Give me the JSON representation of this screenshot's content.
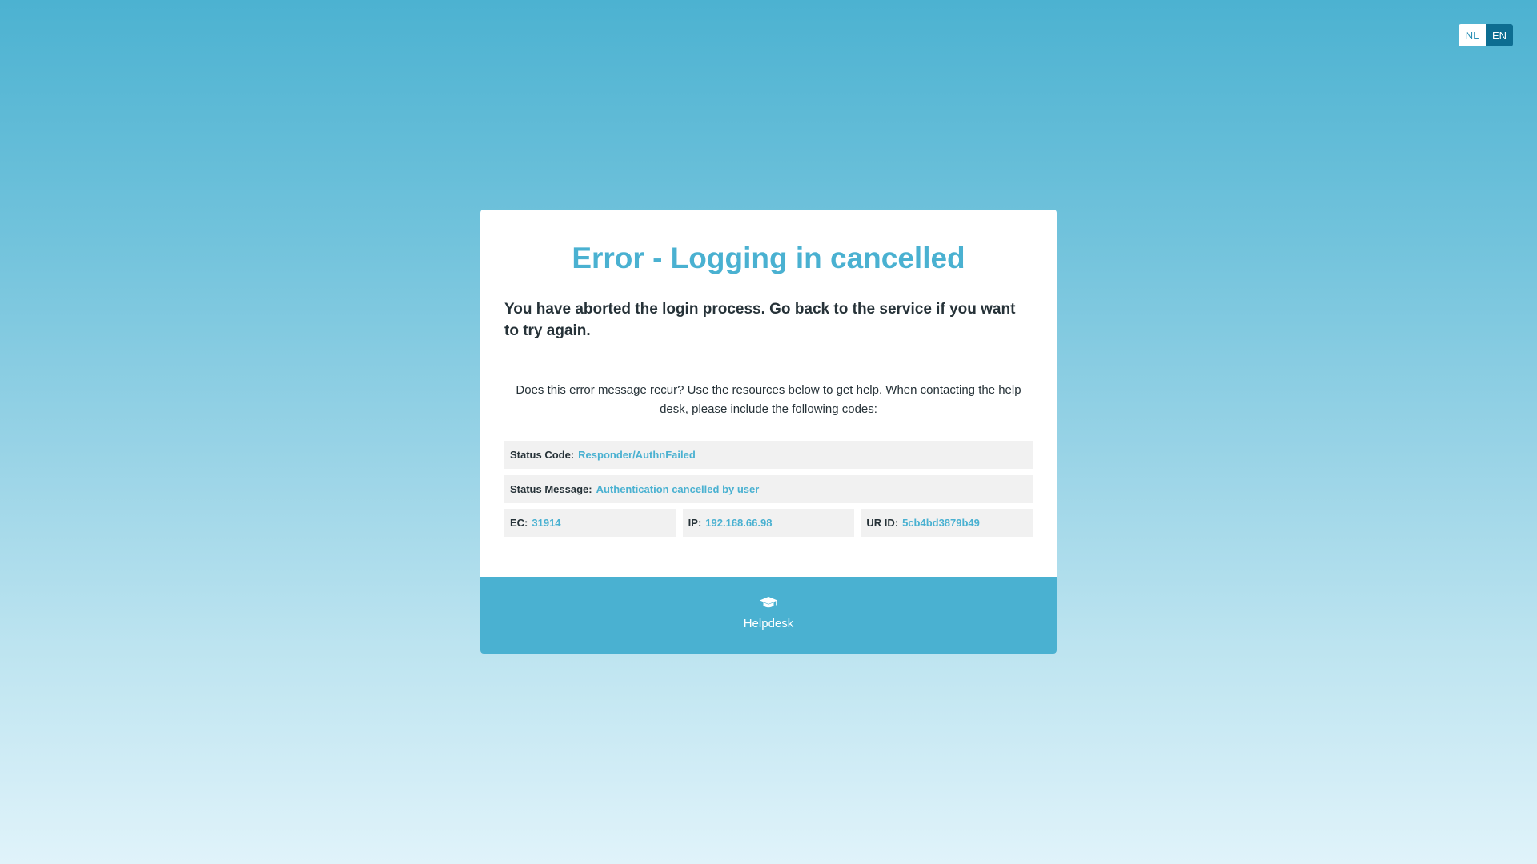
{
  "language": {
    "options": [
      {
        "code": "NL",
        "active": false
      },
      {
        "code": "EN",
        "active": true
      }
    ]
  },
  "error": {
    "title": "Error - Logging in cancelled",
    "subtitle": "You have aborted the login process. Go back to the service if you want to try again.",
    "help_text": "Does this error message recur? Use the resources below to get help. When contacting the help desk, please include the following codes:"
  },
  "codes": {
    "status_code": {
      "label": "Status Code:",
      "value": "Responder/AuthnFailed"
    },
    "status_message": {
      "label": "Status Message:",
      "value": "Authentication cancelled by user"
    },
    "ec": {
      "label": "EC:",
      "value": "31914"
    },
    "ip": {
      "label": "IP:",
      "value": "192.168.66.98"
    },
    "ur_id": {
      "label": "UR ID:",
      "value": "5cb4bd3879b49"
    }
  },
  "footer": {
    "helpdesk": {
      "label": "Helpdesk",
      "icon": "graduation-cap-icon"
    }
  },
  "colors": {
    "accent": "#4ab1d1",
    "active_language": "#0d6d91",
    "code_background": "#f1f1f1"
  }
}
